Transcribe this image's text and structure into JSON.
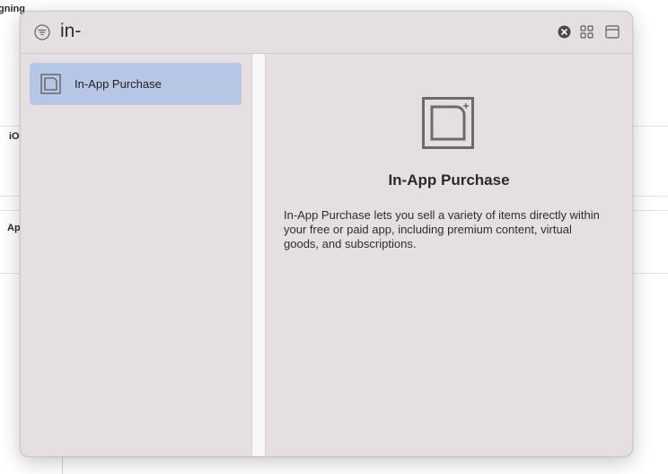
{
  "background": {
    "heading_fragment": "gning",
    "platform_fragment": "iO",
    "row_fragment": "Ap"
  },
  "search": {
    "query": "in-"
  },
  "icons": {
    "filter": "filter-icon",
    "clear": "clear-search-icon",
    "grid_view": "grid-view-icon",
    "panel_toggle": "panel-toggle-icon",
    "capability": "in-app-purchase-icon"
  },
  "results": [
    {
      "label": "In-App Purchase",
      "selected": true
    }
  ],
  "detail": {
    "title": "In-App Purchase",
    "description": "In-App Purchase lets you sell a variety of items directly within your free or paid app, including premium content, virtual goods, and subscriptions."
  },
  "colors": {
    "panel_bg": "#e5dfe2",
    "selection": "#b6c7e6",
    "divider": "#f7f7f7"
  }
}
